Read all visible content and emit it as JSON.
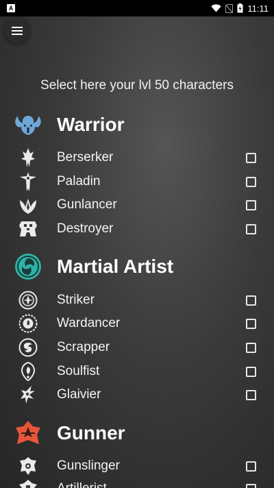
{
  "status_bar": {
    "time": "11:11",
    "app_badge": "A"
  },
  "heading": "Select here your lvl 50 characters",
  "classes": [
    {
      "name": "Warrior",
      "icon": "warrior-icon",
      "color": "#6fa8d8",
      "subclasses": [
        {
          "name": "Berserker",
          "icon": "berserker-icon",
          "checked": false
        },
        {
          "name": "Paladin",
          "icon": "paladin-icon",
          "checked": false
        },
        {
          "name": "Gunlancer",
          "icon": "gunlancer-icon",
          "checked": false
        },
        {
          "name": "Destroyer",
          "icon": "destroyer-icon",
          "checked": false
        }
      ]
    },
    {
      "name": "Martial Artist",
      "icon": "martial-artist-icon",
      "color": "#2fb3a6",
      "subclasses": [
        {
          "name": "Striker",
          "icon": "striker-icon",
          "checked": false
        },
        {
          "name": "Wardancer",
          "icon": "wardancer-icon",
          "checked": false
        },
        {
          "name": "Scrapper",
          "icon": "scrapper-icon",
          "checked": false
        },
        {
          "name": "Soulfist",
          "icon": "soulfist-icon",
          "checked": false
        },
        {
          "name": "Glaivier",
          "icon": "glaivier-icon",
          "checked": false
        }
      ]
    },
    {
      "name": "Gunner",
      "icon": "gunner-icon",
      "color": "#e8553a",
      "subclasses": [
        {
          "name": "Gunslinger",
          "icon": "gunslinger-icon",
          "checked": false
        },
        {
          "name": "Artillerist",
          "icon": "artillerist-icon",
          "checked": false
        }
      ]
    }
  ]
}
